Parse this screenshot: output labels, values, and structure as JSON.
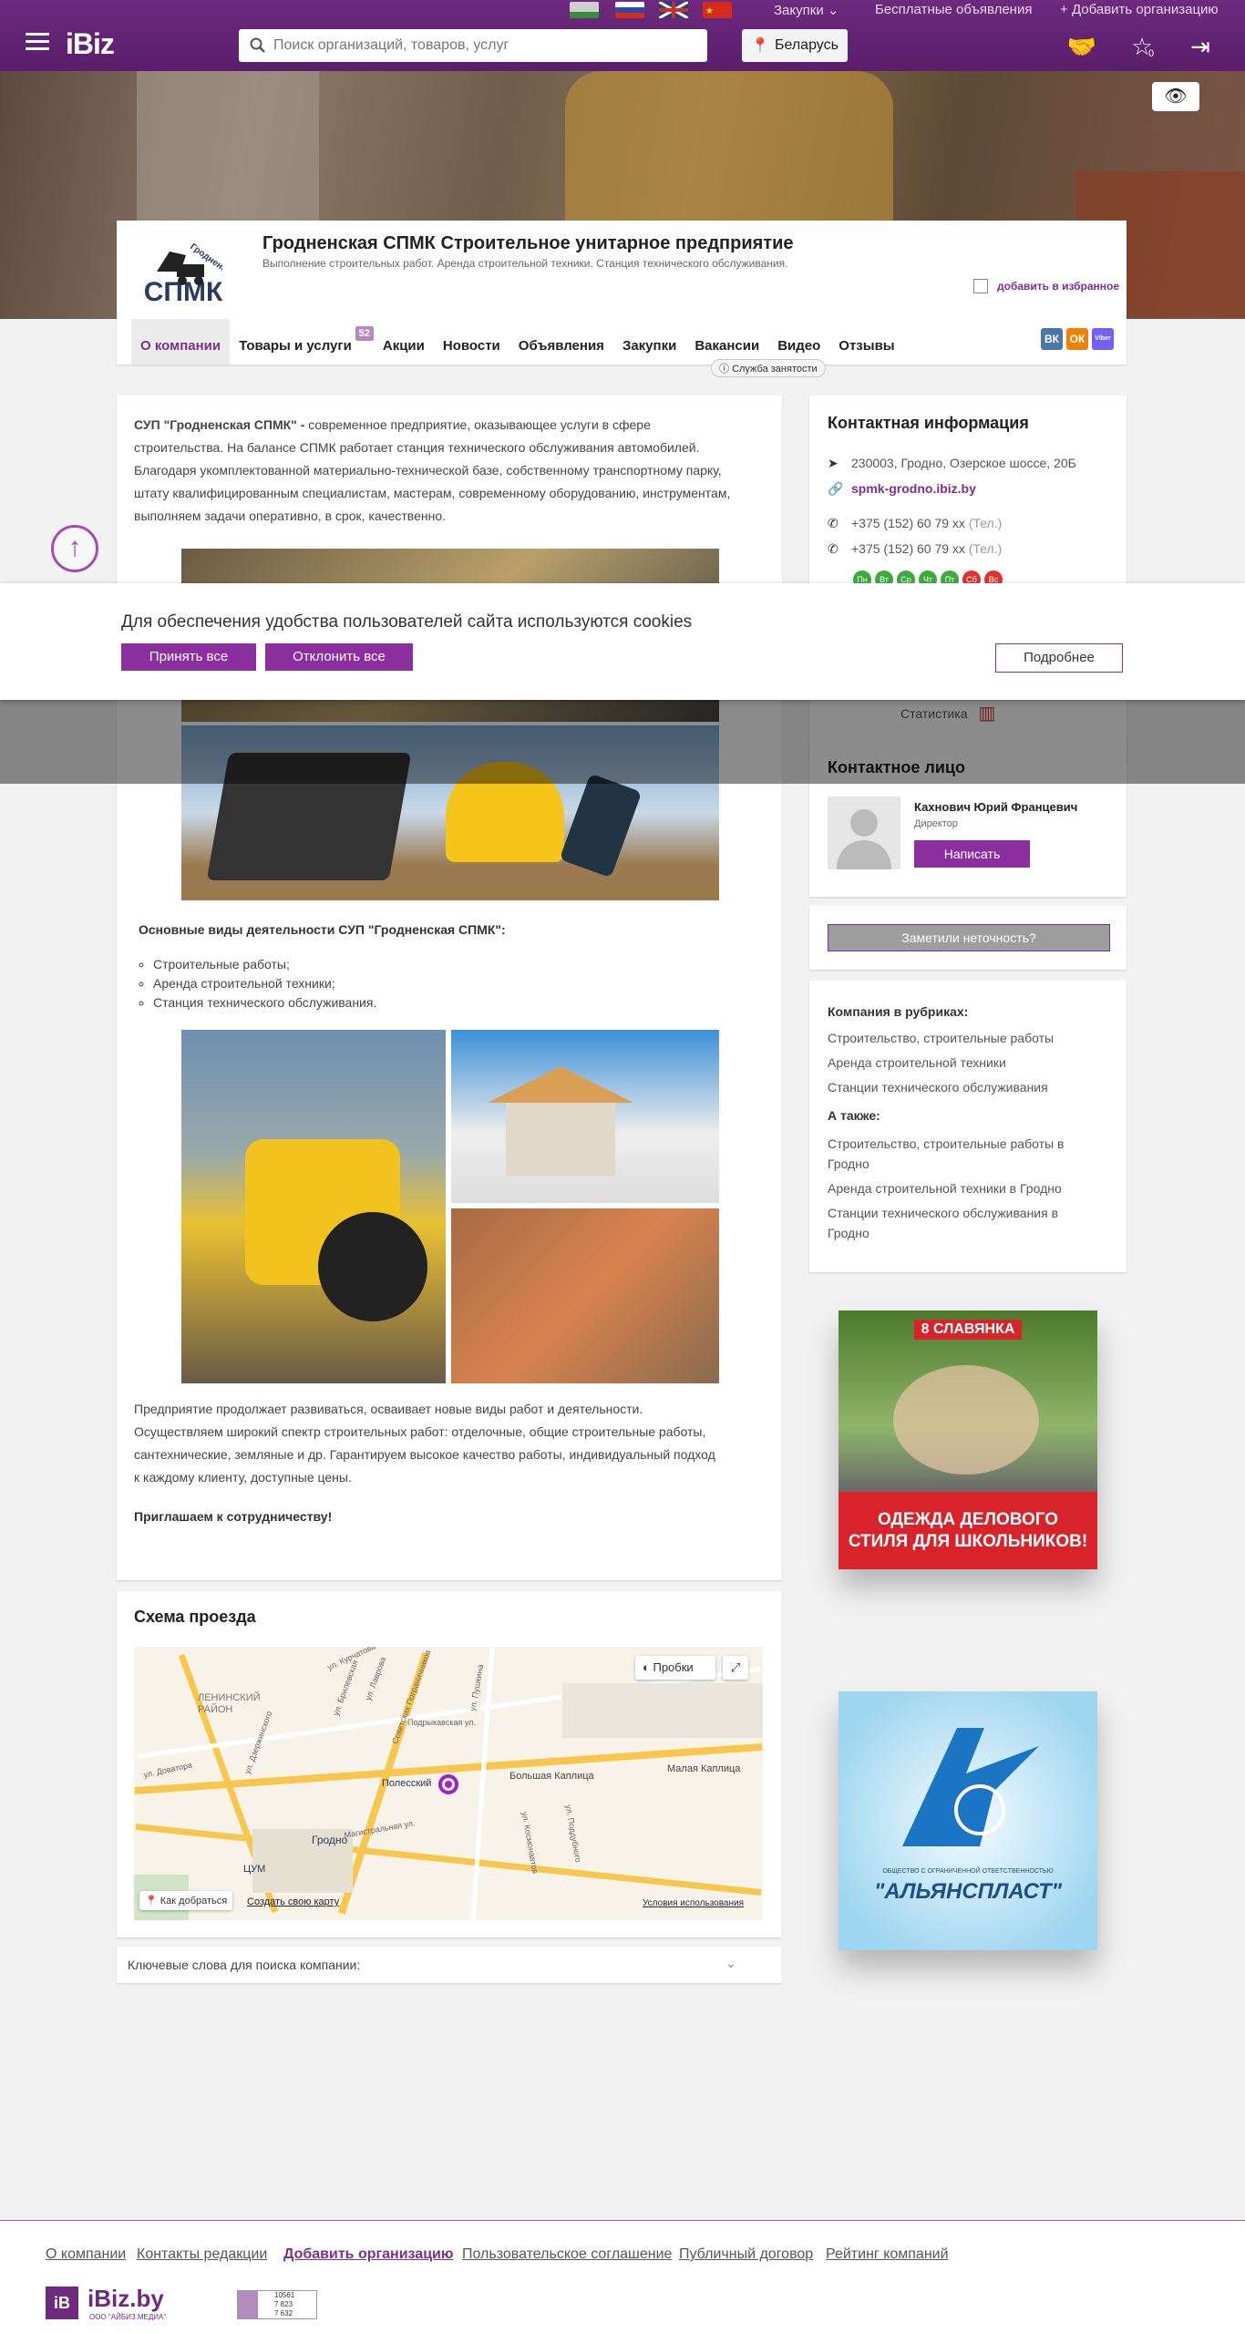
{
  "top": {
    "procurement": "Закупки",
    "free_ads": "Бесплатные объявления",
    "add_org": "Добавить организацию",
    "logo": "iBiz",
    "search_placeholder": "Поиск организаций, товаров, услуг",
    "region": "Беларусь",
    "fav_count": "0"
  },
  "company": {
    "logo_text": "СПМК",
    "logo_arc": "Гродненская",
    "title": "Гродненская СПМК Строительное унитарное предприятие",
    "subtitle": "Выполнение строительных работ. Аренда строительной техники. Станция технического обслуживания.",
    "favorite": "добавить в избранное",
    "tabs": [
      {
        "label": "О компании"
      },
      {
        "label": "Товары и услуги",
        "badge": "52"
      },
      {
        "label": "Акции"
      },
      {
        "label": "Новости"
      },
      {
        "label": "Объявления"
      },
      {
        "label": "Закупки"
      },
      {
        "label": "Вакансии"
      },
      {
        "label": "Видео"
      },
      {
        "label": "Отзывы"
      }
    ],
    "jobs_badge": "Служба занятости",
    "social": [
      "ВК",
      "ОК",
      "Viber"
    ]
  },
  "about": {
    "intro_bold": "СУП \"Гродненская СПМК\" -",
    "intro_lines": [
      " современное предприятие, оказывающее услуги в сфере",
      "строительства. На балансе СПМК работает станция технического обслуживания автомобилей.",
      "Благодаря укомплектованной материально-технической базе, собственному транспортному парку,",
      "штату квалифицированным специалистам, мастерам, современному оборудованию, инструментам,",
      "выполняем задачи оперативно, в срок, качественно."
    ],
    "activities_title": "Основные виды деятельности СУП \"Гродненская СПМК\":",
    "activities": [
      "Строительные работы;",
      "Аренда строительной техники;",
      "Станция технического обслуживания."
    ],
    "outro_lines": [
      "Предприятие продолжает развиваться, осваивает новые виды работ и деятельности.",
      "Осуществляем широкий спектр строительных работ: отделочные, общие строительные работы,",
      "сантехнические, земляные и др.  Гарантируем высокое качество работы, индивидуальный подход",
      "к каждому клиенту, доступные цены."
    ],
    "invite": "Приглашаем к сотрудничеству!"
  },
  "map": {
    "title": "Схема проезда",
    "traffic": "Пробки",
    "route": "Как добраться",
    "create": "Создать свою карту",
    "terms": "Условия использования",
    "labels": {
      "lenin": "ЛЕНИНСКИЙ РАЙОН",
      "grodno": "Гродно",
      "tsum": "ЦУМ",
      "polessky": "Полесский",
      "big": "Большая Каплица",
      "small": "Малая Каплица",
      "kurchatova": "ул. Курчатова",
      "podr": "Подрыкавская ул.",
      "magistr": "Магистральная ул.",
      "dovatora": "ул. Доватора",
      "dzerzh": "ул. Дзержинского",
      "brilevskaya": "ул. Брилевская",
      "lavrova": "ул. Лаврова",
      "sovet": "Советских Пограничников",
      "pushkina": "ул. Пушкина",
      "kosm": "ул. Космонавтов",
      "poddubn": "ул. Поддубного"
    }
  },
  "keywords": "Ключевые слова для поиска компании:",
  "contacts": {
    "title": "Контактная информация",
    "address": "230003, Гродно, Озерское шоссе, 20Б",
    "site": "spmk-grodno.ibiz.by",
    "phones": [
      {
        "num": "+375 (152) 60 79 xx",
        "kind": "(Тел.)"
      },
      {
        "num": "+375 (152) 60 79 xx",
        "kind": "(Тел.)"
      }
    ],
    "days": [
      "Пн",
      "Вт",
      "Ср",
      "Чт",
      "Пт",
      "Сб",
      "Вс"
    ],
    "stats": "Статистика"
  },
  "person": {
    "title": "Контактное лицо",
    "name": "Кахнович Юрий Францевич",
    "role": "Директор",
    "write": "Написать"
  },
  "inaccuracy": "Заметили неточность?",
  "rubrics": {
    "title": "Компания в рубриках:",
    "items": [
      "Строительство, строительные работы",
      "Аренда строительной техники",
      "Станции технического обслуживания"
    ],
    "also_title": "А также:",
    "also": [
      "Строительство, строительные работы в",
      "Гродно",
      "Аренда строительной техники в Гродно",
      "Станции технического обслуживания в",
      "Гродно"
    ]
  },
  "ads": {
    "ad1_brand": "8 СЛАВЯНКА",
    "ad1_line1": "ОДЕЖДА ДЕЛОВОГО",
    "ad1_line2": "СТИЛЯ ДЛЯ ШКОЛЬНИКОВ!",
    "ad2_brand": "\"АЛЬЯНСПЛАСТ\"",
    "ad2_small": "ОБЩЕСТВО С ОГРАНИЧЕННОЙ ОТВЕТСТВЕННОСТЬЮ"
  },
  "cookie": {
    "text": "Для обеспечения удобства пользователей сайта используются cookies",
    "accept": "Принять все",
    "decline": "Отклонить все",
    "more": "Подробнее"
  },
  "footer": {
    "links": [
      "О компании",
      "Контакты редакции",
      "Добавить организацию",
      "Пользовательское соглашение",
      "Публичный договор",
      "Рейтинг компаний"
    ],
    "brand": "iBiz.by",
    "brand_sub": "ООО \"АЙБИЗ МЕДИА\"",
    "counter": [
      "10561",
      "7 823",
      "7 632"
    ]
  },
  "colors": {
    "brand": "#6e2a7e",
    "accent": "#8b2ea0"
  }
}
